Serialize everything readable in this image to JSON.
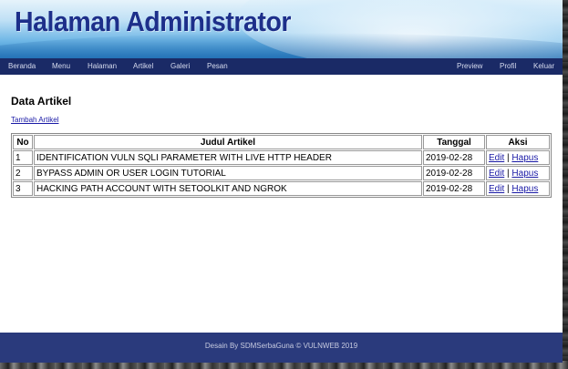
{
  "header": {
    "title": "Halaman Administrator"
  },
  "nav": {
    "left": [
      "Beranda",
      "Menu",
      "Halaman",
      "Artikel",
      "Galeri",
      "Pesan"
    ],
    "right": [
      "Preview",
      "Profil",
      "Keluar"
    ]
  },
  "main": {
    "heading": "Data Artikel",
    "add_link": "Tambah Artikel",
    "table": {
      "headers": [
        "No",
        "Judul Artikel",
        "Tanggal",
        "Aksi"
      ],
      "rows": [
        {
          "no": "1",
          "title": "IDENTIFICATION VULN SQLI PARAMETER WITH LIVE HTTP HEADER",
          "date": "2019-02-28",
          "edit": "Edit",
          "sep": "|",
          "delete": "Hapus"
        },
        {
          "no": "2",
          "title": "BYPASS ADMIN OR USER LOGIN TUTORIAL",
          "date": "2019-02-28",
          "edit": "Edit",
          "sep": "|",
          "delete": "Hapus"
        },
        {
          "no": "3",
          "title": "HACKING PATH ACCOUNT WITH SETOOLKIT AND NGROK",
          "date": "2019-02-28",
          "edit": "Edit",
          "sep": "|",
          "delete": "Hapus"
        }
      ]
    }
  },
  "footer": {
    "text": "Desain By SDMSerbaGuna © VULNWEB 2019"
  }
}
